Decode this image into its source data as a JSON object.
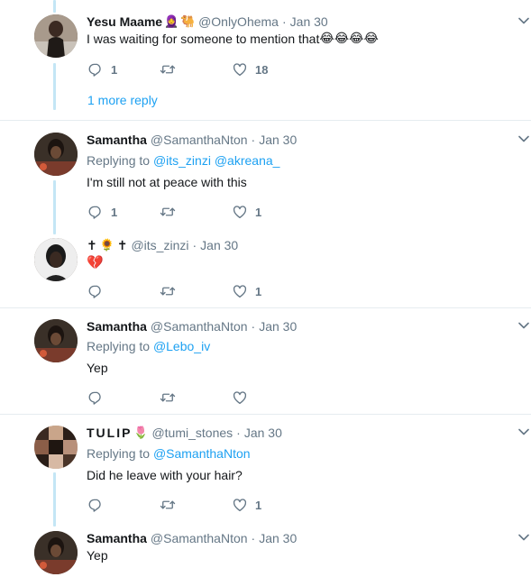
{
  "tweets": [
    {
      "name": "Yesu Maame",
      "badges": [
        "🧕",
        "🐫"
      ],
      "handle": "@OnlyOhema",
      "sep": "·",
      "time": "Jan 30",
      "text": "I was waiting for someone to mention that",
      "text_emojis": [
        "😂",
        "😂",
        "😂",
        "😂"
      ],
      "replies": "1",
      "retweets": "",
      "likes": "18",
      "more_replies": "1 more reply"
    },
    {
      "name": "Samantha",
      "handle": "@SamanthaNton",
      "sep": "·",
      "time": "Jan 30",
      "replying_label": "Replying to",
      "replying_to": [
        "@its_zinzi",
        "@akreana_"
      ],
      "text": "I'm still not at peace with this",
      "replies": "1",
      "retweets": "",
      "likes": "1"
    },
    {
      "name_parts": [
        "✝",
        "🌻",
        "✝"
      ],
      "handle": "@its_zinzi",
      "sep": "·",
      "time": "Jan 30",
      "text_emoji": "💔",
      "replies": "",
      "retweets": "",
      "likes": "1"
    },
    {
      "name": "Samantha",
      "handle": "@SamanthaNton",
      "sep": "·",
      "time": "Jan 30",
      "replying_label": "Replying to",
      "replying_to": [
        "@Lebo_iv"
      ],
      "text": "Yep",
      "replies": "",
      "retweets": "",
      "likes": ""
    },
    {
      "name": "TULIP",
      "badges": [
        "🌷"
      ],
      "handle": "@tumi_stones",
      "sep": "·",
      "time": "Jan 30",
      "replying_label": "Replying to",
      "replying_to": [
        "@SamanthaNton"
      ],
      "text": "Did he leave with your hair?",
      "replies": "",
      "retweets": "",
      "likes": "1"
    },
    {
      "name": "Samantha",
      "handle": "@SamanthaNton",
      "sep": "·",
      "time": "Jan 30",
      "text": "Yep"
    }
  ],
  "icons": {
    "reply": "reply-icon",
    "retweet": "retweet-icon",
    "like": "heart-icon",
    "caret": "chevron-down-icon"
  },
  "colors": {
    "link": "#1da1f2",
    "muted": "#657786",
    "thread_line": "#c4e6f5",
    "divider": "#e6ecf0",
    "text": "#14171a"
  }
}
